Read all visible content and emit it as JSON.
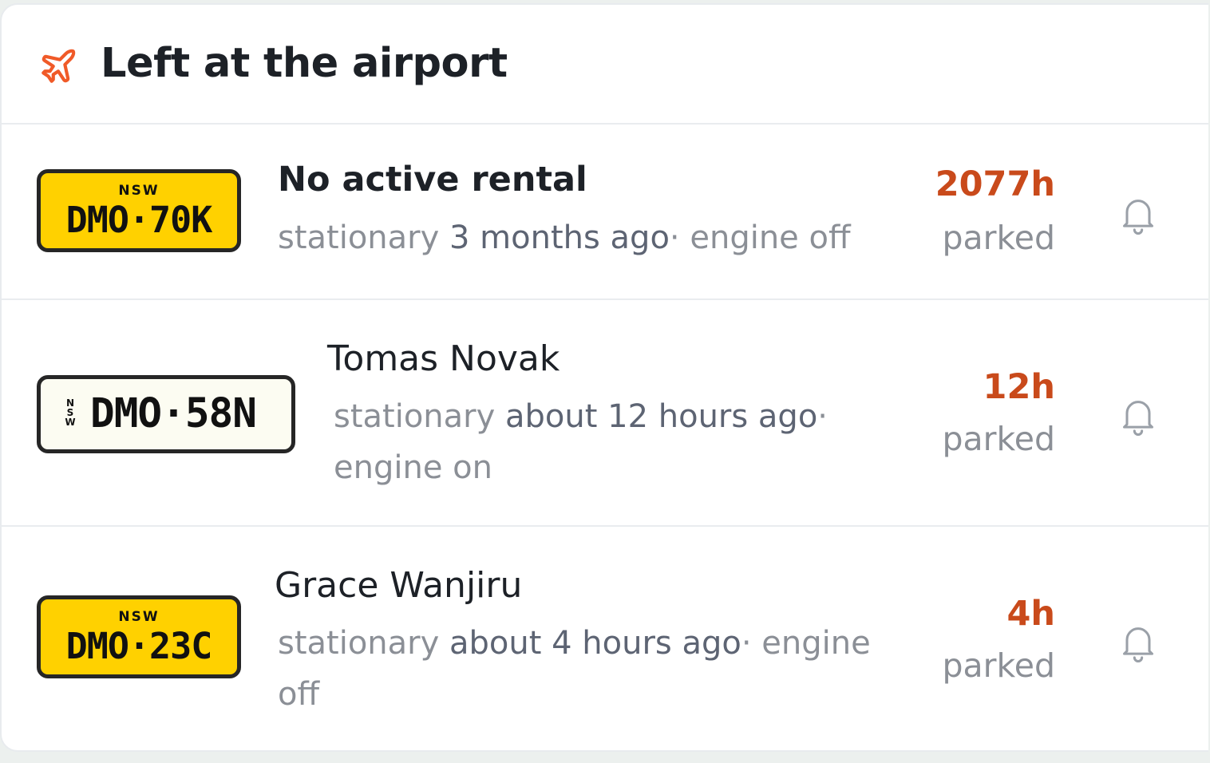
{
  "header": {
    "title": "Left at the airport",
    "icon": "airplane-icon",
    "icon_color": "#f05a28"
  },
  "rows": [
    {
      "plate": {
        "state": "NSW",
        "number": "DMO·70K",
        "style": "yellow"
      },
      "name": "No active rental",
      "status_prefix": "stationary ",
      "status_ago": "3 months ago",
      "status_sep": "·",
      "status_engine": " engine off",
      "duration": "2077h",
      "duration_label": "parked",
      "action_icon": "bell-icon"
    },
    {
      "plate": {
        "state": "NSW",
        "number": "DMO·58N",
        "style": "white"
      },
      "name": "Tomas Novak",
      "status_prefix": "stationary ",
      "status_ago": "about 12 hours ago",
      "status_sep": "·",
      "status_engine": "engine on",
      "duration": "12h",
      "duration_label": "parked",
      "action_icon": "bell-icon"
    },
    {
      "plate": {
        "state": "NSW",
        "number": "DMO·23C",
        "style": "yellow"
      },
      "name": "Grace Wanjiru",
      "status_prefix": "stationary ",
      "status_ago": "about 4 hours ago",
      "status_sep": "·",
      "status_engine": " engine",
      "status_engine_2": "off",
      "duration": "4h",
      "duration_label": "parked",
      "action_icon": "bell-icon"
    }
  ],
  "colors": {
    "accent": "#c94a1b",
    "plate_yellow": "#ffd100",
    "plate_white": "#fcfcf2"
  }
}
